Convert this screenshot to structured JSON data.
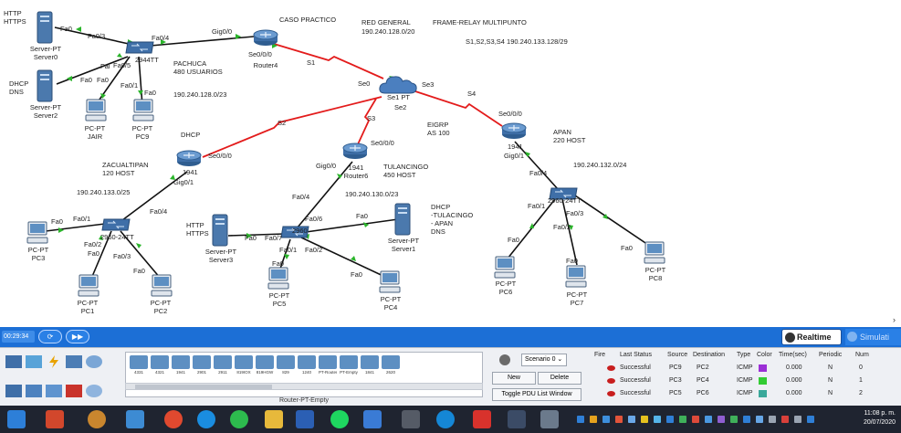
{
  "workspace": {
    "headers": {
      "caso": "CASO PRACTICO",
      "red_general": "RED GENERAL",
      "red_general_ip": "190.240.128.0/20",
      "frame_relay": "FRAME-RELAY MULTIPUNTO",
      "frame_relay_ip": "S1,S2,S3,S4 190.240.133.128/29"
    },
    "notes": {
      "http_top": "HTTP\nHTTPS",
      "dhcp_top": "DHCP\nDNS",
      "pachuca": "PACHUCA\n480 USUARIOS",
      "pachuca_net": "190.240.128.0/23",
      "dhcp_mid": "DHCP",
      "zacualtipan": "ZACUALTIPAN\n120 HOST",
      "zacualtipan_net": "190.240.133.0/25",
      "eigrp": "EIGRP\nAS 100",
      "tulancingo": "TULANCINGO\n450 HOST",
      "tulancingo_net": "190.240.130.0/23",
      "dhcp_tul": "DHCP\n-TULACINGO\n- APAN\nDNS",
      "http_mid": "HTTP\nHTTPS",
      "apan": "APAN\n220 HOST",
      "apan_net": "190.240.132.0/24"
    },
    "devices": {
      "server0": {
        "type": "Server-PT",
        "name": "Server0"
      },
      "server2": {
        "type": "Server-PT",
        "name": "Server2"
      },
      "switch_top": {
        "name": "2944TT"
      },
      "pc_jair": {
        "type": "PC-PT",
        "name": "JAIR"
      },
      "pc9": {
        "type": "PC-PT",
        "name": "PC9"
      },
      "router4": {
        "name": "Router4"
      },
      "frame_cloud": {
        "name": "Se1 PT"
      },
      "router_zac": {
        "model": "1941"
      },
      "switch_zac": {
        "name": "2960-24TT"
      },
      "pc3": {
        "type": "PC-PT",
        "name": "PC3"
      },
      "pc1": {
        "type": "PC-PT",
        "name": "PC1"
      },
      "pc2": {
        "type": "PC-PT",
        "name": "PC2"
      },
      "router6": {
        "model": "1941",
        "name": "Router6"
      },
      "switch_tul": {
        "name": "2960"
      },
      "server3": {
        "type": "Server-PT",
        "name": "Server3"
      },
      "server1": {
        "type": "Server-PT",
        "name": "Server1"
      },
      "pc5": {
        "type": "PC-PT",
        "name": "PC5"
      },
      "pc4": {
        "type": "PC-PT",
        "name": "PC4"
      },
      "router_apan": {
        "model": "1941"
      },
      "switch_apan": {
        "name": "2960-24TT"
      },
      "pc6": {
        "type": "PC-PT",
        "name": "PC6"
      },
      "pc7": {
        "type": "PC-PT",
        "name": "PC7"
      },
      "pc8": {
        "type": "PC-PT",
        "name": "PC8"
      }
    },
    "ports": {
      "fa0_s0": "Fa0",
      "fa03_top": "Fa0/3",
      "fa04_top": "Fa0/4",
      "gig00_top": "Gig0/0",
      "fa0_s2": "Fa0",
      "fa05_top": "Fa0/5",
      "fai_top": "Fai",
      "fa0_jair": "Fa0",
      "fa01_top": "Fa0/1",
      "fa0_pc9": "Fa0",
      "se000_r4": "Se0/0/0",
      "s1": "S1",
      "se0": "Se0",
      "se3": "Se3",
      "se2": "Se2",
      "s4": "S4",
      "s3": "S3",
      "s2": "S2",
      "se000_zac": "Se0/0/0",
      "gig01_zac": "Gig0/1",
      "fa04_zac": "Fa0/4",
      "fa01_zac": "Fa0/1",
      "fa0_pc3": "Fa0",
      "fa02_zac": "Fa0/2",
      "fa03_zac": "Fa0/3",
      "fa0_pc1": "Fa0",
      "fa0_pc2": "Fa0",
      "se000_r6": "Se0/0/0",
      "gig00_r6": "Gig0/0",
      "fa04_tul": "Fa0/4",
      "fa06_tul": "Fa0/6",
      "fa0_tul": "Fa0",
      "fa07_tul": "Fa0/7",
      "fa0_s3": "Fa0",
      "fa01_tul": "Fa0/1",
      "fa02_tul": "Fa0/2",
      "fa0_pc5": "Fa0",
      "fa0_pc4": "Fa0",
      "se000_apan": "Se0/0/0",
      "gig01_apan": "Gig0/1",
      "fa04_apan": "Fa0/4",
      "fa01_apan": "Fa0/1",
      "fa03_apan": "Fa0/3",
      "fa02_apan": "Fa0/2",
      "fa0_pc6": "Fa0",
      "fa0_pc7": "Fa0",
      "fa0_pc8": "Fa0"
    }
  },
  "timebar": {
    "time": "00:29:34",
    "realtime_label": "Realtime",
    "simulation_label": "Simulati"
  },
  "bottom": {
    "models": [
      "4331",
      "4321",
      "1941",
      "2901",
      "2911",
      "819IOX",
      "819HGW",
      "829",
      "1240",
      "PT-Router",
      "PT-Empty",
      "1841",
      "2620"
    ],
    "selected_device": "Router-PT-Empty",
    "scenario": "Scenario 0",
    "new_label": "New",
    "delete_label": "Delete",
    "toggle_label": "Toggle PDU List Window",
    "pdu_headers": [
      "Fire",
      "Last Status",
      "Source",
      "Destination",
      "Type",
      "Color",
      "Time(sec)",
      "Periodic",
      "Num"
    ],
    "pdu_rows": [
      {
        "status": "Successful",
        "source": "PC9",
        "destination": "PC2",
        "type": "ICMP",
        "color": "#9b2fd6",
        "time": "0.000",
        "periodic": "N",
        "num": "0"
      },
      {
        "status": "Successful",
        "source": "PC3",
        "destination": "PC4",
        "type": "ICMP",
        "color": "#33cc33",
        "time": "0.000",
        "periodic": "N",
        "num": "1"
      },
      {
        "status": "Successful",
        "source": "PC5",
        "destination": "PC6",
        "type": "ICMP",
        "color": "#3aa89a",
        "time": "0.000",
        "periodic": "N",
        "num": "2"
      }
    ]
  },
  "taskbar": {
    "time": "11:08 p. m.",
    "date": "20/07/2020"
  },
  "colors": {
    "serial_link": "#e31b1b",
    "ethernet_link": "#111111",
    "link_up": "#2bb52b",
    "device_blue": "#3f6fa8",
    "timebar": "#1c6fd6"
  }
}
